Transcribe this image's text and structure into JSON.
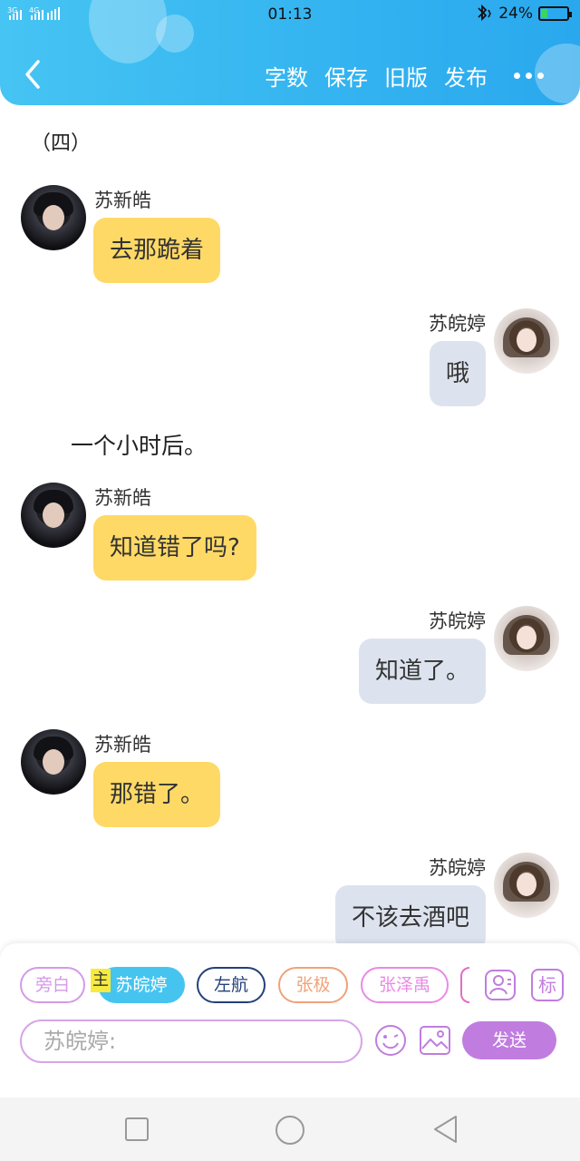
{
  "status_bar": {
    "network": "3G 4G",
    "time": "01:13",
    "battery_percent": "24%",
    "battery_level": 0.24
  },
  "header": {
    "actions": [
      "字数",
      "保存",
      "旧版",
      "发布"
    ],
    "colors": {
      "gradient_start": "#46c4f3",
      "gradient_end": "#2aa8ee"
    }
  },
  "content": {
    "chapter_title": "（四）",
    "narration": "一个小时后。",
    "messages": [
      {
        "side": "left",
        "sender": "苏新皓",
        "text": "去那跪着"
      },
      {
        "side": "right",
        "sender": "苏皖婷",
        "text": "哦"
      },
      {
        "side": "left",
        "sender": "苏新皓",
        "text": "知道错了吗?"
      },
      {
        "side": "right",
        "sender": "苏皖婷",
        "text": "知道了。"
      },
      {
        "side": "left",
        "sender": "苏新皓",
        "text": "那错了。"
      },
      {
        "side": "right",
        "sender": "苏皖婷",
        "text": "不该去酒吧"
      }
    ]
  },
  "composer": {
    "main_tag": "主",
    "roles": [
      {
        "label": "旁白",
        "color": "#d49ae6"
      },
      {
        "label": "苏皖婷",
        "color": "#46c4f0",
        "active": true
      },
      {
        "label": "左航",
        "color": "#24407a"
      },
      {
        "label": "张极",
        "color": "#f0a27a"
      },
      {
        "label": "张泽禹",
        "color": "#e88ae6"
      }
    ],
    "role_icon": "person-icon",
    "mark_label": "标",
    "input_placeholder": "苏皖婷:",
    "emoji_icon": "smile-icon",
    "image_icon": "image-icon",
    "send_label": "发送",
    "send_color": "#c07ddf"
  },
  "system_nav": {
    "icons": [
      "square-icon",
      "circle-icon",
      "triangle-back-icon"
    ]
  }
}
